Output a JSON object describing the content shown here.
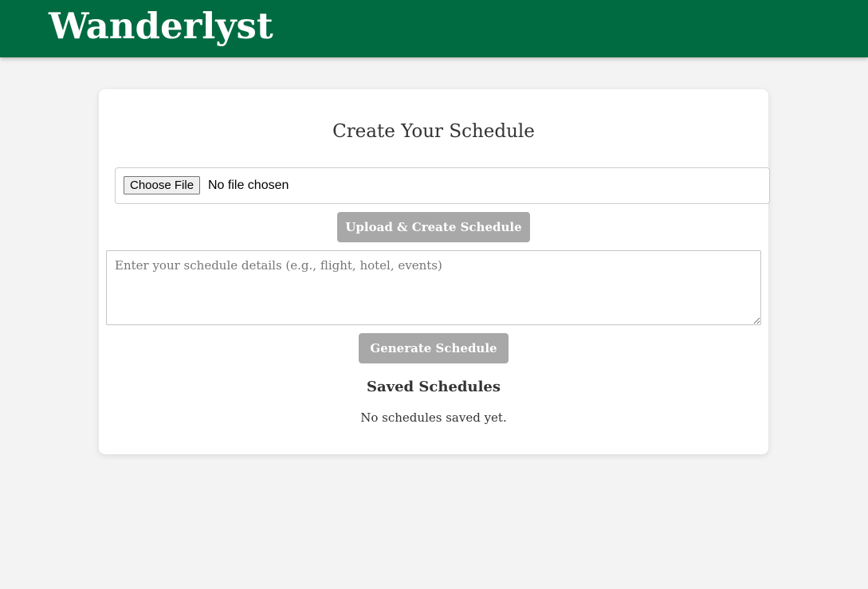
{
  "header": {
    "brand": "Wanderlyst"
  },
  "colors": {
    "header_bg": "#006b41",
    "page_bg": "#f3f3f3",
    "button_bg": "#a8a8a8"
  },
  "main": {
    "title": "Create Your Schedule",
    "file_input": {
      "button_label": "Choose File",
      "status_text": "No file chosen"
    },
    "upload_button_label": "Upload & Create Schedule",
    "details_input": {
      "value": "",
      "placeholder": "Enter your schedule details (e.g., flight, hotel, events)"
    },
    "generate_button_label": "Generate Schedule",
    "saved": {
      "title": "Saved Schedules",
      "empty_text": "No schedules saved yet."
    }
  }
}
